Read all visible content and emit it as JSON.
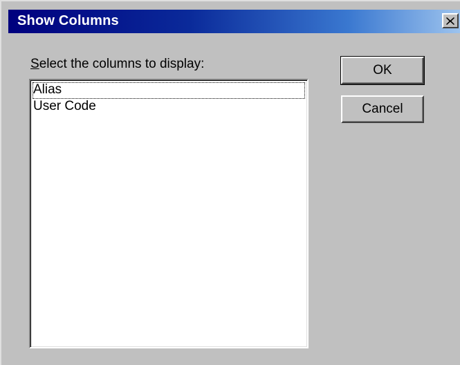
{
  "dialog": {
    "title": "Show Columns",
    "close_icon": "close-icon",
    "prompt_first_letter": "S",
    "prompt_rest": "elect the columns to display:",
    "columns": [
      {
        "label": "Alias",
        "focused": true
      },
      {
        "label": "User Code",
        "focused": false
      }
    ],
    "ok_label": "OK",
    "cancel_label": "Cancel"
  },
  "colors": {
    "face": "#c0c0c0",
    "title_start": "#00007e",
    "title_end": "#9ec4ee"
  }
}
